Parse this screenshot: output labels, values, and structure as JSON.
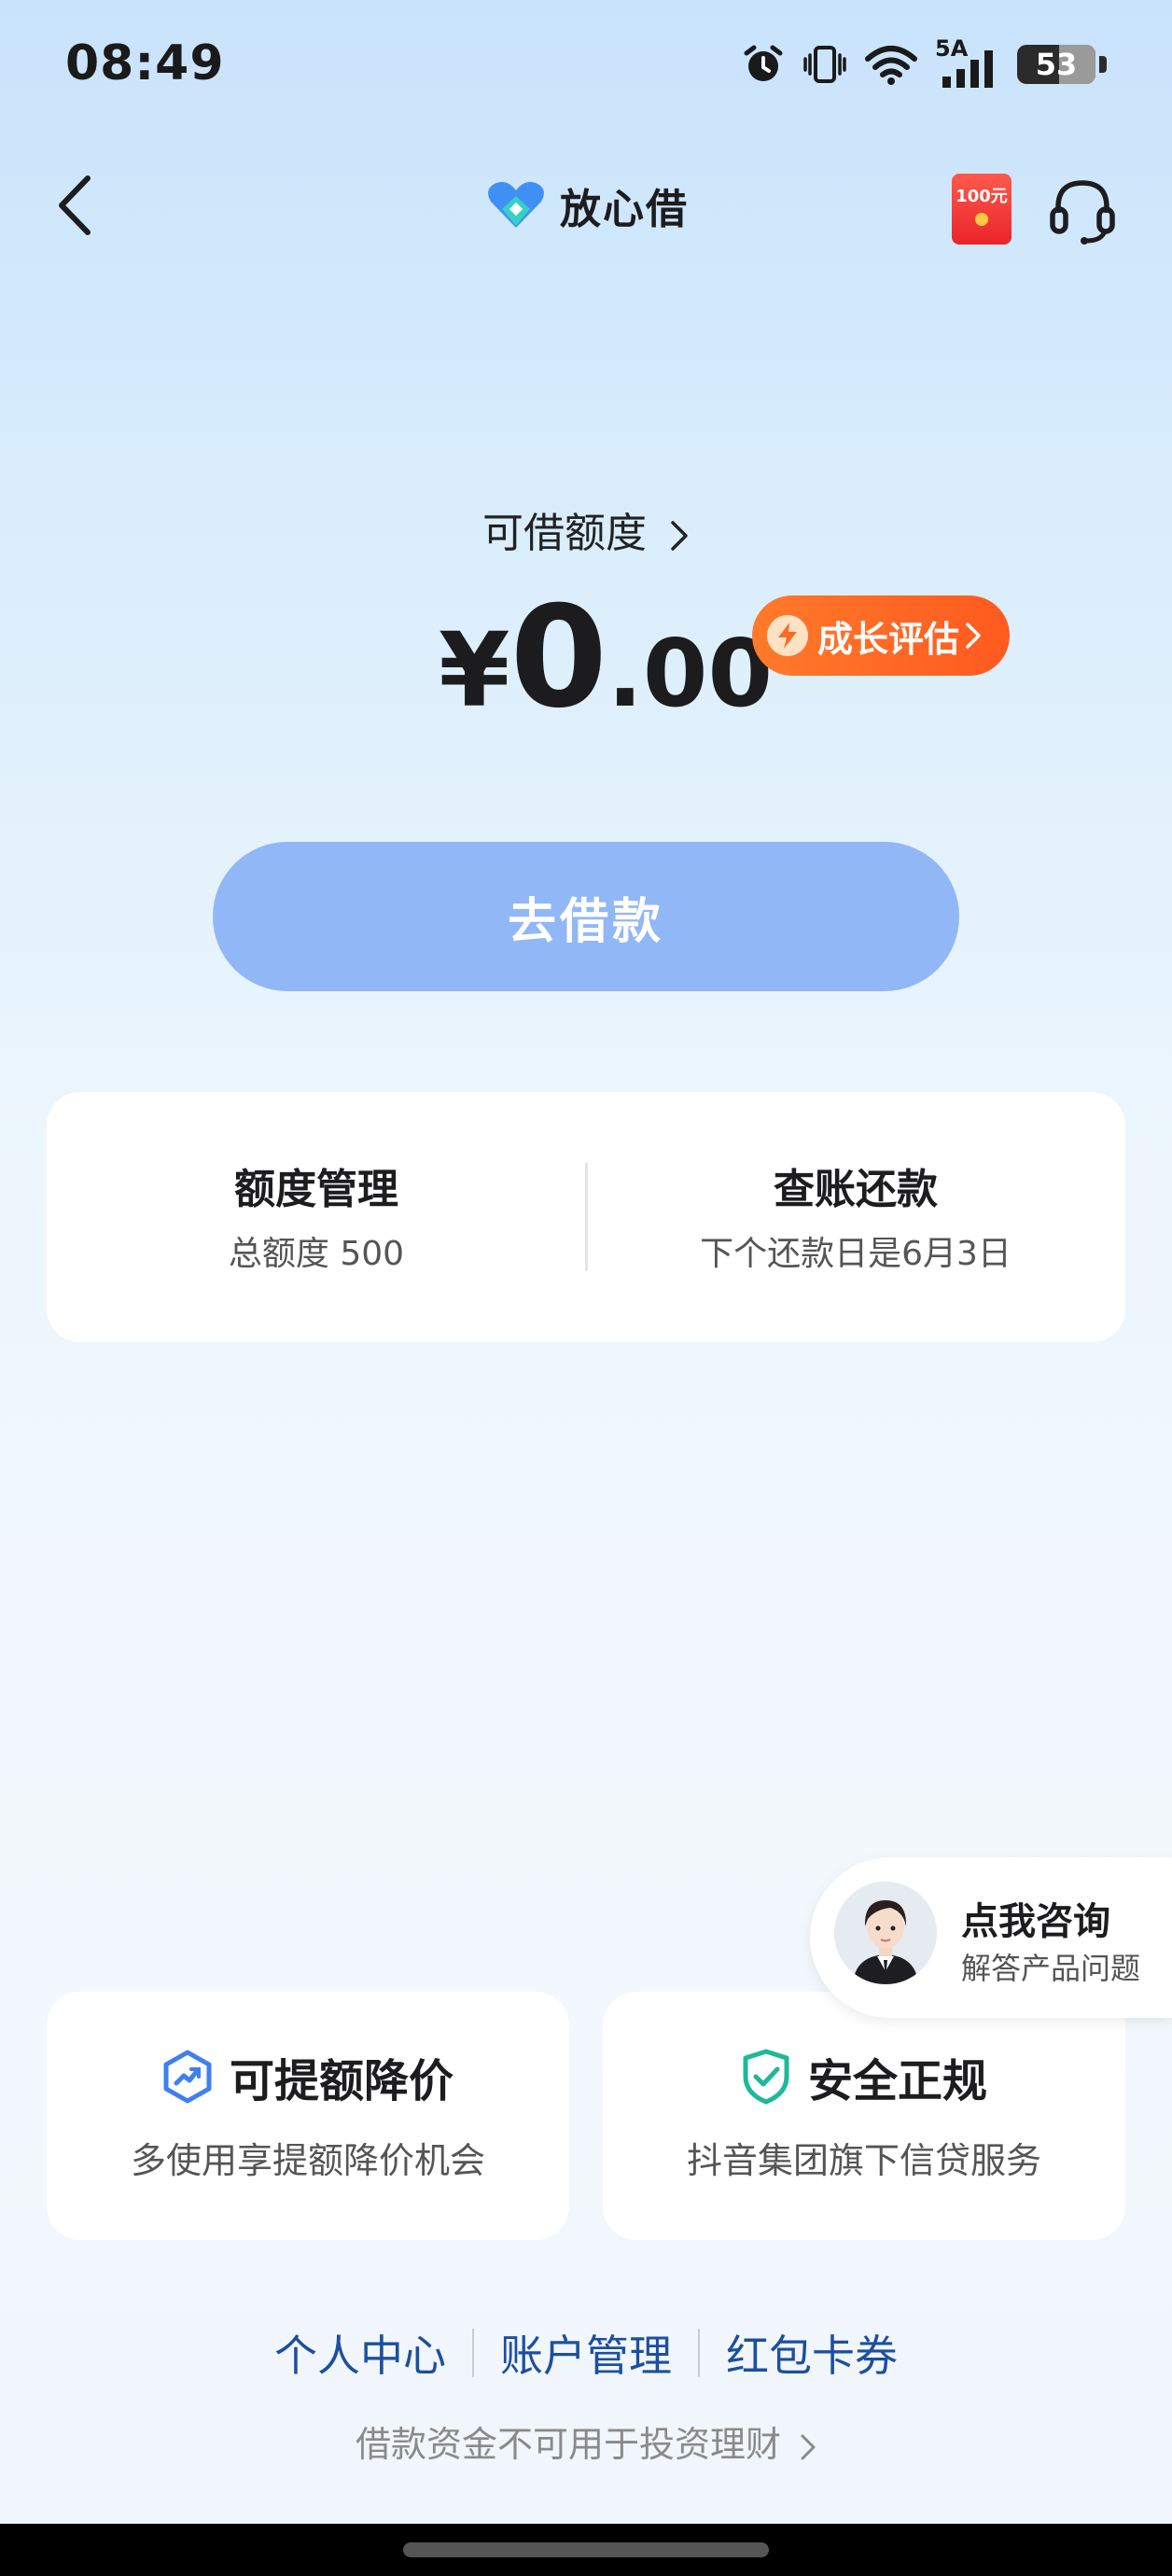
{
  "status_bar": {
    "time": "08:49",
    "network": "5A",
    "battery": "53",
    "battery_level": 0.53
  },
  "header": {
    "title": "放心借",
    "redpacket_label": "100元"
  },
  "credit": {
    "label": "可借额度",
    "currency": "¥",
    "amount_int": "0",
    "amount_dec": ".00",
    "growth_label": "成长评估",
    "borrow_label": "去借款"
  },
  "manage": {
    "left_title": "额度管理",
    "left_sub": "总额度 500",
    "right_title": "查账还款",
    "right_sub": "下个还款日是6月3日"
  },
  "consult": {
    "title": "点我咨询",
    "subtitle": "解答产品问题"
  },
  "features": [
    {
      "title": "可提额降价",
      "subtitle": "多使用享提额降价机会",
      "icon": "trend-up-icon",
      "color": "#3f7ff0"
    },
    {
      "title": "安全正规",
      "subtitle": "抖音集团旗下信贷服务",
      "icon": "shield-check-icon",
      "color": "#1fb89a"
    }
  ],
  "footer": {
    "links": [
      "个人中心",
      "账户管理",
      "红包卡券"
    ],
    "disclaimer": "借款资金不可用于投资理财"
  },
  "colors": {
    "accent": "#91b7f6",
    "orange": "#ff6a24",
    "link": "#1d4f9e"
  }
}
